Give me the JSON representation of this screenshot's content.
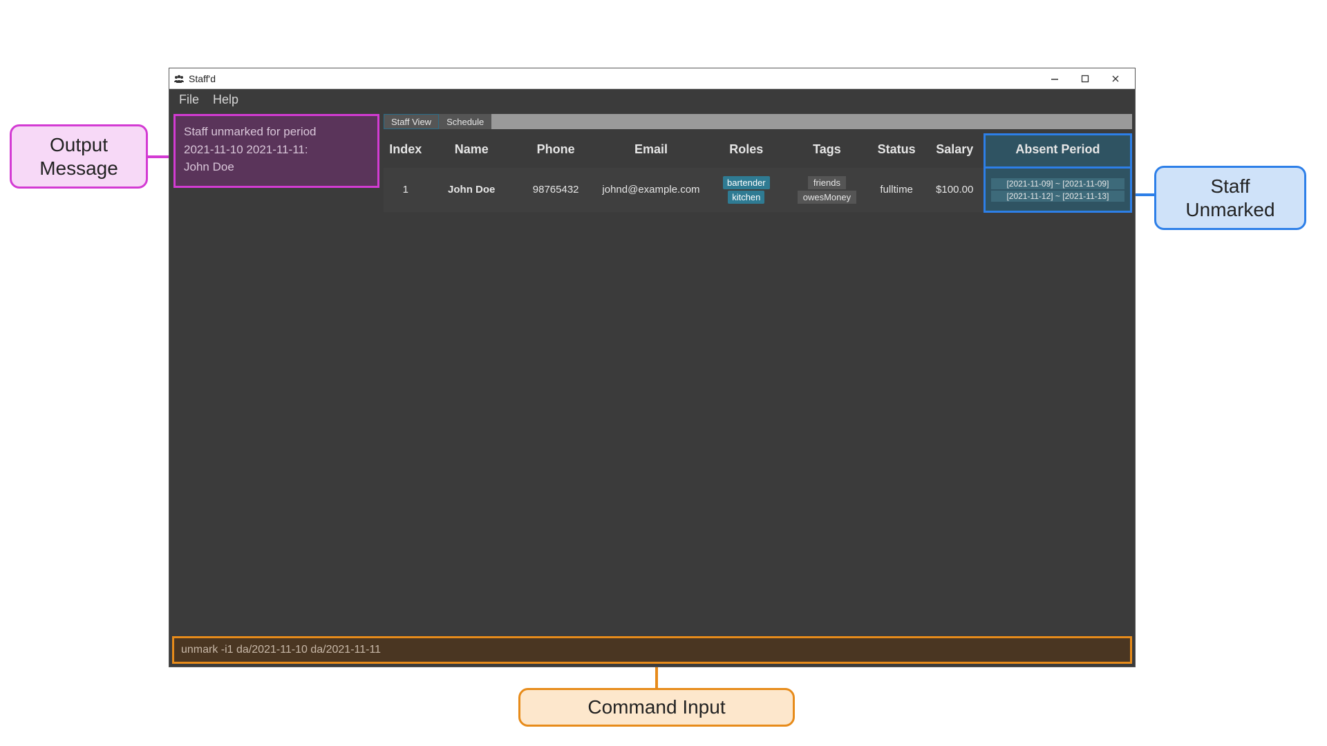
{
  "window": {
    "title": "Staff'd"
  },
  "menubar": {
    "file": "File",
    "help": "Help"
  },
  "output_message": {
    "line1": "Staff unmarked for period",
    "line2": "2021-11-10 2021-11-11:",
    "line3": "John Doe"
  },
  "tabs": {
    "staff_view": "Staff View",
    "schedule": "Schedule"
  },
  "headers": {
    "index": "Index",
    "name": "Name",
    "phone": "Phone",
    "email": "Email",
    "roles": "Roles",
    "tags": "Tags",
    "status": "Status",
    "salary": "Salary",
    "absent": "Absent Period"
  },
  "row": {
    "index": "1",
    "name": "John Doe",
    "phone": "98765432",
    "email": "johnd@example.com",
    "roles": [
      "bartender",
      "kitchen"
    ],
    "tags": [
      "friends",
      "owesMoney"
    ],
    "status": "fulltime",
    "salary": "$100.00",
    "absent": [
      "[2021-11-09] ~ [2021-11-09]",
      "[2021-11-12] ~ [2021-11-13]"
    ]
  },
  "command_input": "unmark -i1 da/2021-11-10 da/2021-11-11",
  "callouts": {
    "output_message": "Output Message",
    "staff_unmarked": "Staff Unmarked",
    "command_input": "Command Input"
  }
}
